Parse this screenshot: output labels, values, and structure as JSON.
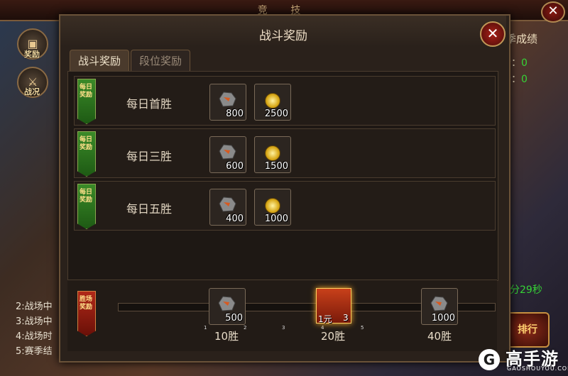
{
  "screen_title": "竞 技",
  "side_buttons": [
    {
      "label": "奖励",
      "icon": "reward-chest-icon"
    },
    {
      "label": "战况",
      "icon": "crossed-swords-icon"
    }
  ],
  "left_list": [
    "2:战场中",
    "3:战场中",
    "4:战场时",
    "5:赛季结"
  ],
  "right_panel": {
    "title": "季成绩",
    "stats": [
      {
        "label": "场：",
        "value": "0"
      },
      {
        "label": "场：",
        "value": "0"
      }
    ],
    "timer": "分29秒",
    "rank_button": "排行"
  },
  "watermark": {
    "logo": "G",
    "name": "高手游",
    "url": "GAOSHOUYOU.COM"
  },
  "modal": {
    "title": "战斗奖励",
    "tabs": [
      "战斗奖励",
      "段位奖励"
    ],
    "daily_banner": "每日奖励",
    "rows": [
      {
        "label": "每日首胜",
        "rewards": [
          {
            "icon": "ore-icon",
            "qty": "800"
          },
          {
            "icon": "coin-icon",
            "qty": "2500"
          }
        ]
      },
      {
        "label": "每日三胜",
        "rewards": [
          {
            "icon": "ore-icon",
            "qty": "600"
          },
          {
            "icon": "coin-icon",
            "qty": "1500"
          }
        ]
      },
      {
        "label": "每日五胜",
        "rewards": [
          {
            "icon": "ore-icon",
            "qty": "400"
          },
          {
            "icon": "coin-icon",
            "qty": "1000"
          }
        ]
      }
    ],
    "battle_banner": "胜场奖励",
    "milestones": [
      {
        "label": "10胜",
        "icon": "ore-icon",
        "qty": "500"
      },
      {
        "label": "20胜",
        "icon": "red-box-icon",
        "qty": "1元",
        "qty2": "3"
      },
      {
        "label": "40胜",
        "icon": "ore-icon",
        "qty": "1000"
      }
    ],
    "tick_labels": [
      "1",
      "2",
      "3",
      "4",
      "5"
    ]
  },
  "colors": {
    "accent_green": "#36d436",
    "gold": "#ffe08a",
    "panel": "#2a211b"
  }
}
